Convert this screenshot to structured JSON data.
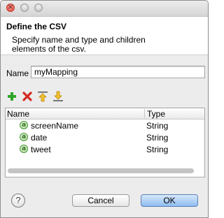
{
  "header": {
    "title": "Define the CSV",
    "description": "Specify name and type and children elements of the csv."
  },
  "name_field": {
    "label": "Name",
    "value": "myMapping"
  },
  "toolbar": {
    "add_icon": "add-icon",
    "delete_icon": "delete-icon",
    "move_up_icon": "move-up-icon",
    "move_down_icon": "move-down-icon"
  },
  "table": {
    "columns": [
      "Name",
      "Type"
    ],
    "rows": [
      {
        "name": "screenName",
        "type": "String",
        "icon": "attribute-icon"
      },
      {
        "name": "date",
        "type": "String",
        "icon": "attribute-icon"
      },
      {
        "name": "tweet",
        "type": "String",
        "icon": "attribute-icon"
      }
    ]
  },
  "buttons": {
    "help": "?",
    "cancel": "Cancel",
    "ok": "OK"
  },
  "colors": {
    "ok_button": "#8fbcef",
    "add_icon": "#2fa52a",
    "delete_icon": "#d32a22",
    "arrow_icons": "#e7b21b"
  }
}
